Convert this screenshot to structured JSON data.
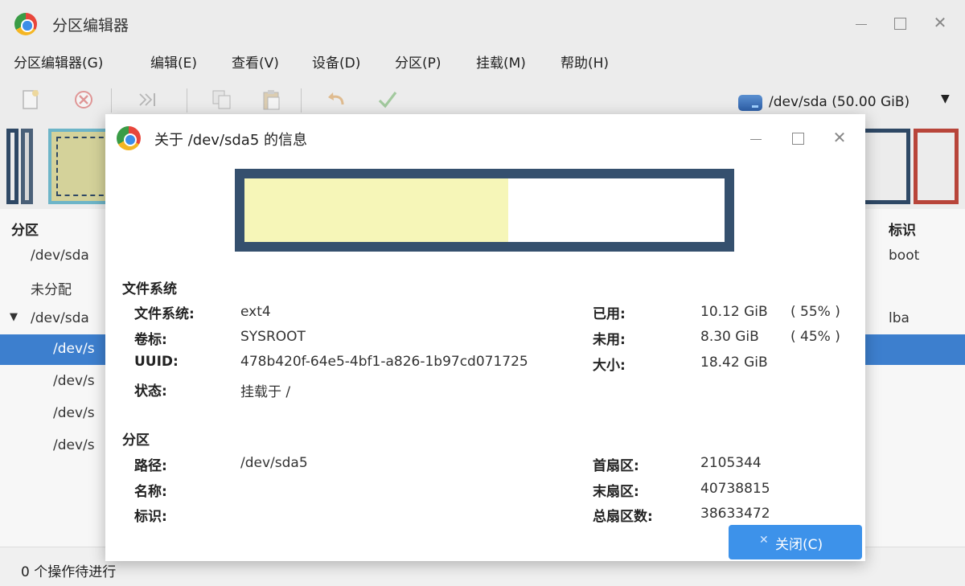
{
  "window": {
    "title": "分区编辑器"
  },
  "menu": [
    "分区编辑器(G)",
    "编辑(E)",
    "查看(V)",
    "设备(D)",
    "分区(P)",
    "挂载(M)",
    "帮助(H)"
  ],
  "toolbar": {
    "icons": [
      "new-icon",
      "delete-icon",
      "apply-icon",
      "copy-icon",
      "paste-icon",
      "undo-icon",
      "check-icon"
    ],
    "device": "/dev/sda (50.00 GiB)"
  },
  "partition_list": {
    "headers": {
      "partition": "分区",
      "flags": "标识"
    },
    "rows": [
      {
        "device": "/dev/sda",
        "flags": "boot",
        "selected": false,
        "child": false
      },
      {
        "device": "未分配",
        "flags": "",
        "selected": false,
        "child": false
      },
      {
        "device": "/dev/sda",
        "flags": "lba",
        "selected": false,
        "child": false,
        "expander": "▼"
      },
      {
        "device": "/dev/s",
        "flags": "",
        "selected": true,
        "child": true
      },
      {
        "device": "/dev/s",
        "flags": "",
        "selected": false,
        "child": true
      },
      {
        "device": "/dev/s",
        "flags": "",
        "selected": false,
        "child": true
      },
      {
        "device": "/dev/s",
        "flags": "",
        "selected": false,
        "child": true
      }
    ]
  },
  "status": "0 个操作待进行",
  "dialog": {
    "title": "关于 /dev/sda5 的信息",
    "usage_fraction": 0.55,
    "filesystem_section": {
      "title": "文件系统",
      "labels": {
        "filesystem": "文件系统:",
        "label": "卷标:",
        "uuid": "UUID:",
        "status": "状态:",
        "used": "已用:",
        "unused": "未用:",
        "size": "大小:"
      },
      "values": {
        "filesystem": "ext4",
        "label": "SYSROOT",
        "uuid": "478b420f-64e5-4bf1-a826-1b97cd071725",
        "status": "挂载于 /",
        "used": "10.12 GiB",
        "used_pct": "( 55% )",
        "unused": "8.30 GiB",
        "unused_pct": "( 45% )",
        "size": "18.42 GiB"
      }
    },
    "partition_section": {
      "title": "分区",
      "labels": {
        "path": "路径:",
        "name": "名称:",
        "flags": "标识:",
        "first_sector": "首扇区:",
        "last_sector": "末扇区:",
        "total_sectors": "总扇区数:"
      },
      "values": {
        "path": "/dev/sda5",
        "first_sector": "2105344",
        "last_sector": "40738815",
        "total_sectors": "38633472"
      }
    },
    "close_button": "关闭(C)"
  },
  "colors": {
    "accent": "#3d92ea",
    "selection": "#3d7fce",
    "border": "#35506e",
    "used_fill": "#f6f6b8"
  }
}
